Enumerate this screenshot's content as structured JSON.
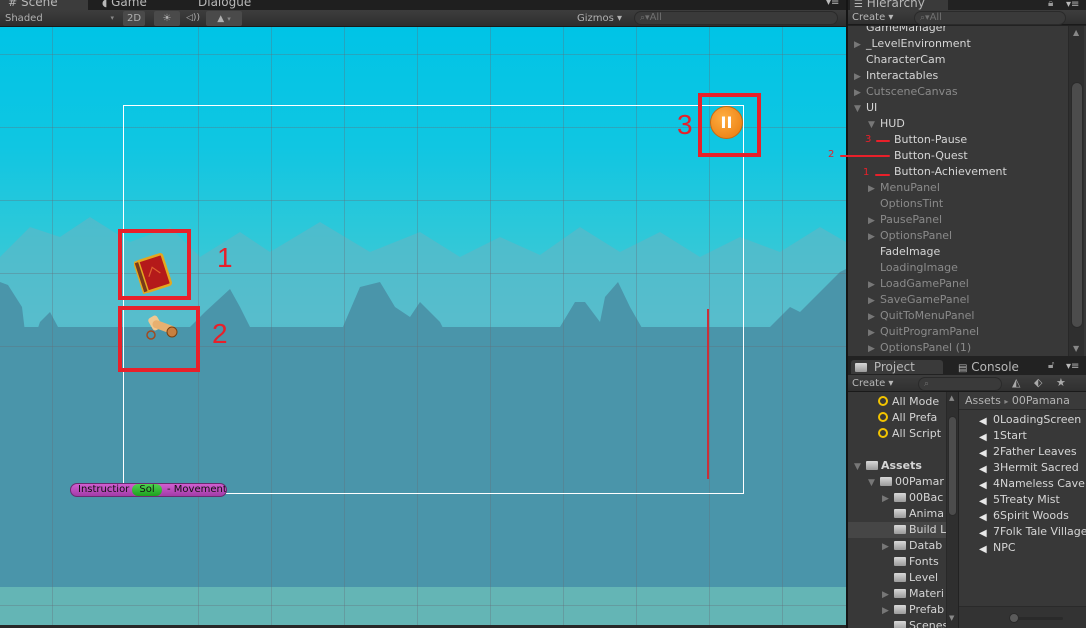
{
  "scene": {
    "tabs": [
      {
        "label": "Scene",
        "icon": "grid-icon",
        "active": true
      },
      {
        "label": "Game",
        "icon": "pacman-icon",
        "active": false
      },
      {
        "label": "Dialogue",
        "active": false
      }
    ],
    "toolbar": {
      "shading_mode": "Shaded",
      "mode_2d": "2D",
      "lighting_icon": "☀",
      "audio_icon": "◁))",
      "effects_icon": "▲",
      "gizmos_label": "Gizmos ▾",
      "search_placeholder": "All",
      "panel_menu_icon": "▾≡"
    },
    "ui": {
      "annotations": [
        "1",
        "2",
        "3"
      ],
      "instruction_pill": {
        "left_text": "Instructior",
        "middle_text": "Sol",
        "right_text": "- Movement"
      },
      "pause_glyph": "II"
    }
  },
  "hierarchy": {
    "tab_label": "Hierarchy",
    "create_label": "Create ▾",
    "search_placeholder": "All",
    "items": [
      {
        "label": "GameManager",
        "expand": "",
        "indent": 0,
        "style": "bright"
      },
      {
        "label": "_LevelEnvironment",
        "expand": "▶",
        "indent": 0,
        "style": "bright"
      },
      {
        "label": "CharacterCam",
        "expand": "",
        "indent": 0,
        "style": "bright"
      },
      {
        "label": "Interactables",
        "expand": "▶",
        "indent": 0,
        "style": "bright"
      },
      {
        "label": "CutsceneCanvas",
        "expand": "▶",
        "indent": 0,
        "style": "dim"
      },
      {
        "label": "UI",
        "expand": "▼",
        "indent": 0,
        "style": "bright"
      },
      {
        "label": "HUD",
        "expand": "▼",
        "indent": 1,
        "style": "bright"
      },
      {
        "label": "Button-Pause",
        "expand": "",
        "indent": 2,
        "style": "bright"
      },
      {
        "label": "Button-Quest",
        "expand": "",
        "indent": 2,
        "style": "bright"
      },
      {
        "label": "Button-Achievement",
        "expand": "",
        "indent": 2,
        "style": "bright"
      },
      {
        "label": "MenuPanel",
        "expand": "▶",
        "indent": 1,
        "style": "dim"
      },
      {
        "label": "OptionsTint",
        "expand": "",
        "indent": 1,
        "style": "dim"
      },
      {
        "label": "PausePanel",
        "expand": "▶",
        "indent": 1,
        "style": "dim"
      },
      {
        "label": "OptionsPanel",
        "expand": "▶",
        "indent": 1,
        "style": "dim"
      },
      {
        "label": "FadeImage",
        "expand": "",
        "indent": 1,
        "style": "bright"
      },
      {
        "label": "LoadingImage",
        "expand": "",
        "indent": 1,
        "style": "dim"
      },
      {
        "label": "LoadGamePanel",
        "expand": "▶",
        "indent": 1,
        "style": "dim"
      },
      {
        "label": "SaveGamePanel",
        "expand": "▶",
        "indent": 1,
        "style": "dim"
      },
      {
        "label": "QuitToMenuPanel",
        "expand": "▶",
        "indent": 1,
        "style": "dim"
      },
      {
        "label": "QuitProgramPanel",
        "expand": "▶",
        "indent": 1,
        "style": "dim"
      },
      {
        "label": "OptionsPanel (1)",
        "expand": "▶",
        "indent": 1,
        "style": "dim"
      }
    ],
    "annotations": [
      {
        "label": "3",
        "target": "Button-Pause"
      },
      {
        "label": "2",
        "target": "Button-Quest"
      },
      {
        "label": "1",
        "target": "Button-Achievement"
      }
    ]
  },
  "project": {
    "tabs": [
      {
        "label": "Project",
        "active": true
      },
      {
        "label": "Console",
        "active": false
      }
    ],
    "create_label": "Create ▾",
    "favorites": [
      "All Mode",
      "All Prefa",
      "All Script"
    ],
    "tree": [
      {
        "label": "Assets",
        "expand": "▼",
        "indent": 0,
        "bold": true
      },
      {
        "label": "00Pamar",
        "expand": "▼",
        "indent": 1
      },
      {
        "label": "00Bac",
        "expand": "▶",
        "indent": 2
      },
      {
        "label": "Anima",
        "expand": "",
        "indent": 2
      },
      {
        "label": "Build L",
        "expand": "",
        "indent": 2,
        "selected": true
      },
      {
        "label": "Datab",
        "expand": "▶",
        "indent": 2
      },
      {
        "label": "Fonts",
        "expand": "",
        "indent": 2
      },
      {
        "label": "Level",
        "expand": "",
        "indent": 2
      },
      {
        "label": "Materi",
        "expand": "▶",
        "indent": 2
      },
      {
        "label": "Prefab",
        "expand": "▶",
        "indent": 2
      },
      {
        "label": "Scenes",
        "expand": "",
        "indent": 2
      }
    ],
    "breadcrumb": [
      "Assets",
      "00Pamana"
    ],
    "breadcrumb_separator": "▸",
    "files": [
      "0LoadingScreen",
      "1Start",
      "2Father Leaves",
      "3Hermit Sacred",
      "4Nameless Cave",
      "5Treaty Mist",
      "6Spirit Woods",
      "7Folk Tale Village",
      "NPC"
    ],
    "zoom_slider_value": 0.0
  },
  "colors": {
    "annotation_red": "#e8202a",
    "sky_top": "#00c4e6",
    "ground": "#4a95aa",
    "pause_orange": "#f08a1a",
    "pill_magenta": "#c050c8",
    "pill_green": "#3cc43c"
  }
}
